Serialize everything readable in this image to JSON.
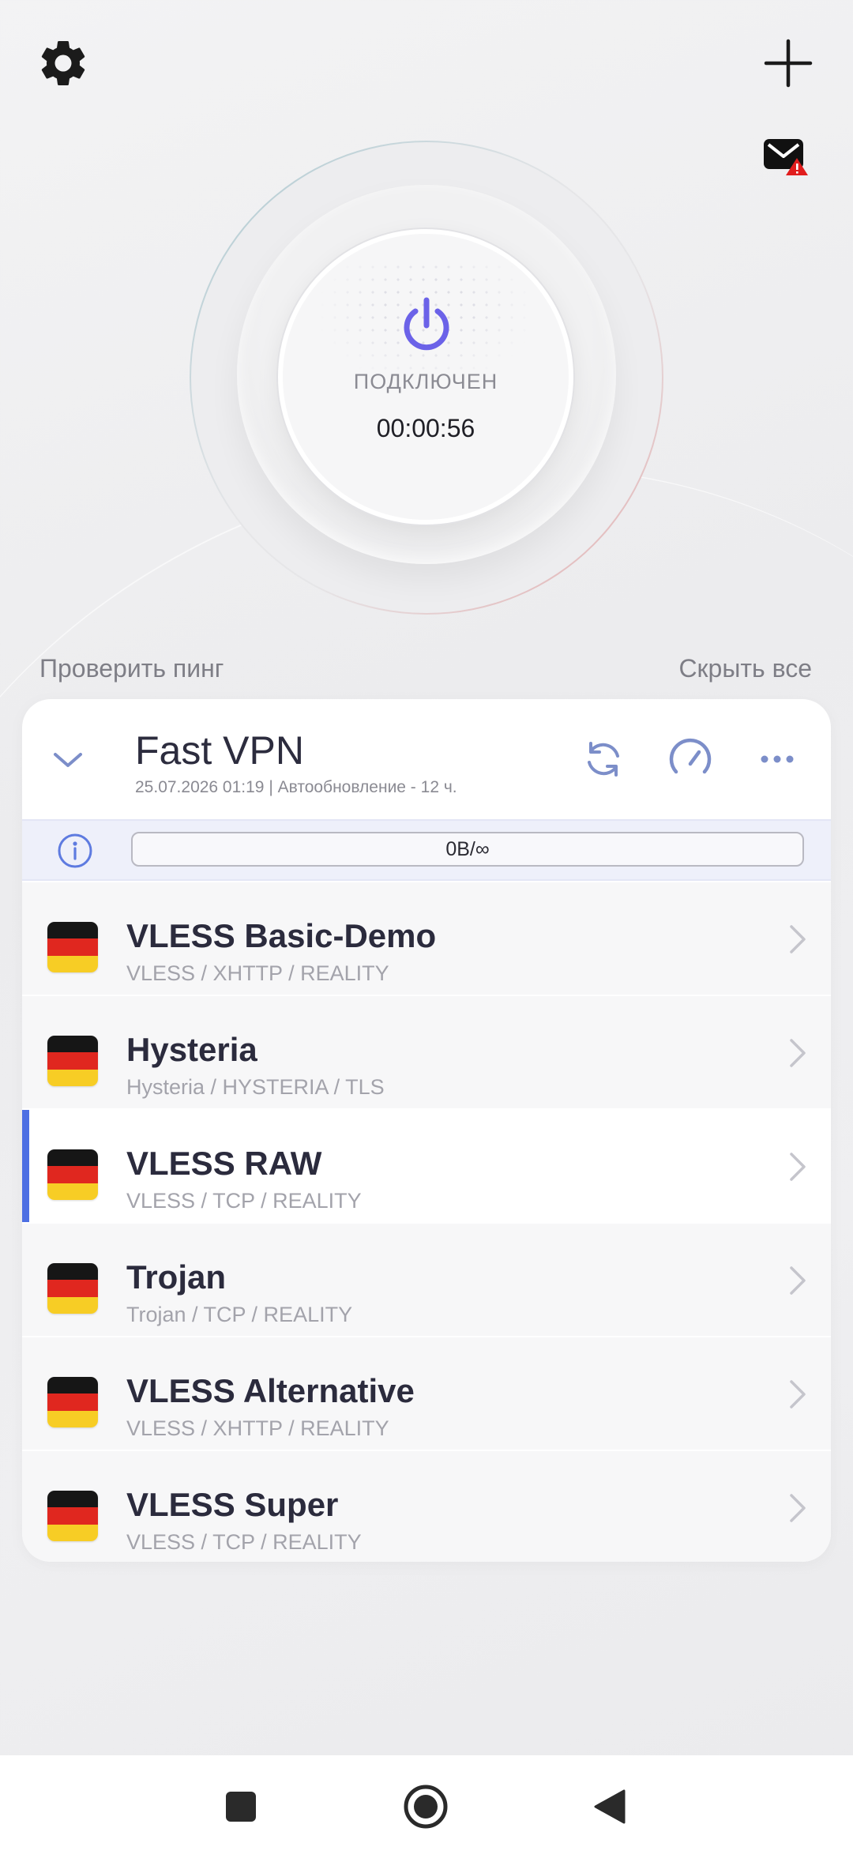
{
  "header": {
    "settings_icon": "gear-icon",
    "add_icon": "plus-icon",
    "mail_icon": "mail-warning-icon"
  },
  "connection": {
    "status": "ПОДКЛЮЧЕН",
    "timer": "00:00:56",
    "accent_color": "#6b62e8"
  },
  "actions": {
    "check_ping": "Проверить пинг",
    "hide_all": "Скрыть все"
  },
  "group": {
    "name": "Fast VPN",
    "meta": "25.07.2026 01:19 | Автообновление - 12 ч.",
    "traffic": "0B/∞"
  },
  "servers": [
    {
      "name": "VLESS Basic-Demo",
      "sub": "VLESS / XHTTP / REALITY",
      "country": "DE",
      "selected": false
    },
    {
      "name": "Hysteria",
      "sub": "Hysteria / HYSTERIA / TLS",
      "country": "DE",
      "selected": false
    },
    {
      "name": "VLESS RAW",
      "sub": "VLESS / TCP / REALITY",
      "country": "DE",
      "selected": true
    },
    {
      "name": "Trojan",
      "sub": "Trojan / TCP / REALITY",
      "country": "DE",
      "selected": false
    },
    {
      "name": "VLESS Alternative",
      "sub": "VLESS / XHTTP / REALITY",
      "country": "DE",
      "selected": false
    },
    {
      "name": "VLESS Super",
      "sub": "VLESS / TCP / REALITY",
      "country": "DE",
      "selected": false
    }
  ]
}
